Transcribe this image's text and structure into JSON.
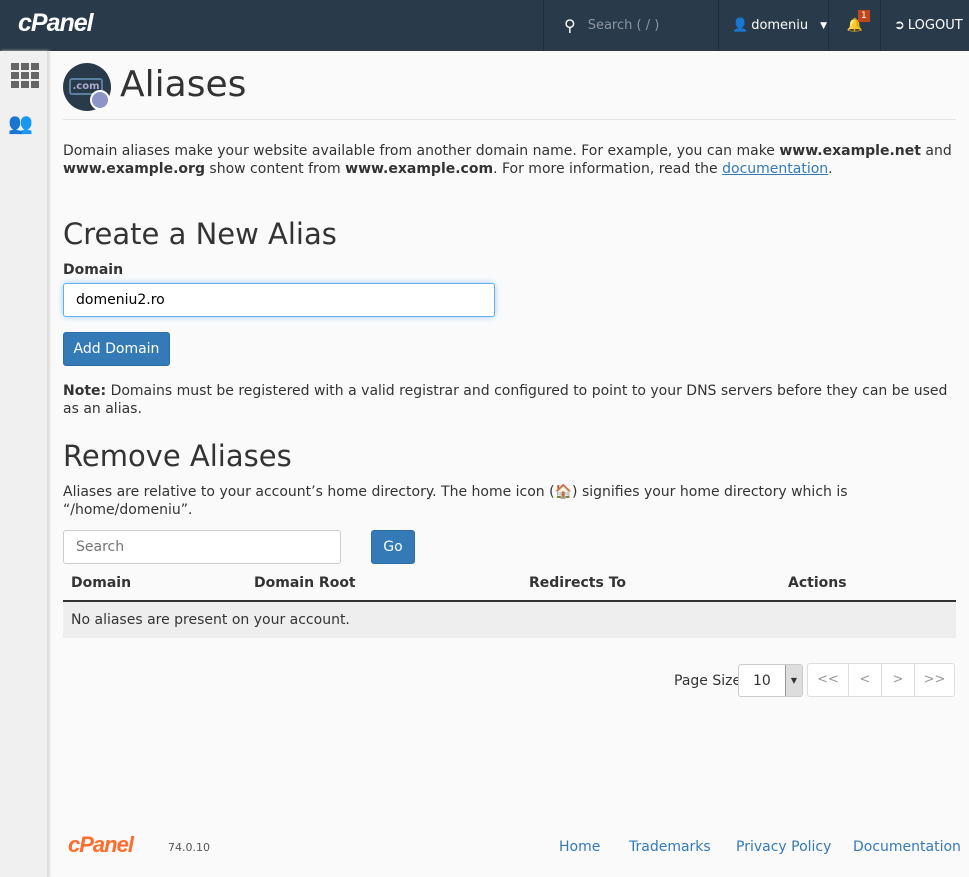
{
  "header": {
    "logo": "cPanel",
    "search_placeholder": "Search ( / )",
    "user": "domeniu",
    "notifications": "1",
    "logout": "LOGOUT"
  },
  "page": {
    "title": "Aliases",
    "icon_text": ".com",
    "intro_1": "Domain aliases make your website available from another domain name. For example, you can make ",
    "intro_b1": "www.example.net",
    "intro_2": " and ",
    "intro_b2": "www.example.org",
    "intro_3": " show content from ",
    "intro_b3": "www.example.com",
    "intro_4": ". For more information, read the ",
    "intro_link": "documentation",
    "intro_5": "."
  },
  "create": {
    "title": "Create a New Alias",
    "domain_label": "Domain",
    "domain_value": "domeniu2.ro",
    "add_button": "Add Domain",
    "note_label": "Note:",
    "note_text": " Domains must be registered with a valid registrar and configured to point to your DNS servers before they can be used as an alias."
  },
  "remove": {
    "title": "Remove Aliases",
    "desc_1": "Aliases are relative to your account’s home directory. The home icon (",
    "desc_2": ") signifies your home directory which is “/home/domeniu”.",
    "search_placeholder": "Search",
    "go": "Go",
    "columns": [
      "Domain",
      "Domain Root",
      "Redirects To",
      "Actions"
    ],
    "empty": "No aliases are present on your account.",
    "page_size_label": "Page Size",
    "page_size": "10",
    "pager": [
      "<<",
      "<",
      ">",
      ">>"
    ]
  },
  "footer": {
    "logo": "cPanel",
    "version": "74.0.10",
    "links": [
      "Home",
      "Trademarks",
      "Privacy Policy",
      "Documentation"
    ]
  },
  "colors": {
    "topbar": "#293a4a",
    "primary": "#337ab7",
    "brand_orange": "#ff6c2c"
  }
}
